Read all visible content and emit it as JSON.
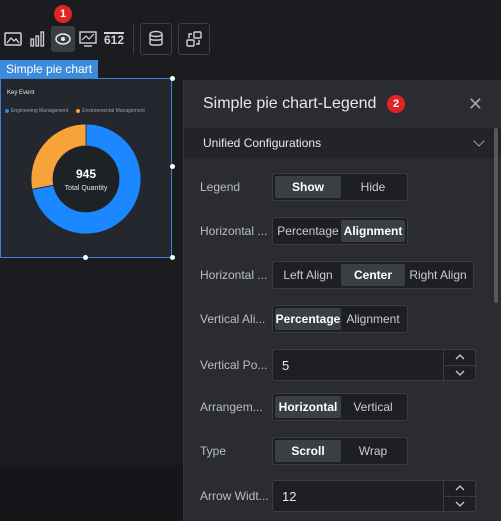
{
  "toolbar": {
    "icons": [
      "image-icon",
      "bar-chart-icon",
      "eye-icon",
      "screen-icon",
      "number-icon",
      "database-icon",
      "exchange-icon"
    ],
    "number_text": "612",
    "badge": "1"
  },
  "component": {
    "label": "Simple pie chart",
    "chart_title": "Key Event",
    "legend": [
      {
        "name": "Engineering Management",
        "color": "#1b88ff"
      },
      {
        "name": "Environmental Management",
        "color": "#f7a33a"
      }
    ],
    "total_value": "945",
    "total_label": "Total Quantity"
  },
  "chart_data": {
    "type": "pie",
    "title": "Key Event",
    "series": [
      {
        "name": "Engineering Management",
        "values": [
          0.72
        ]
      },
      {
        "name": "Environmental Management",
        "values": [
          0.28
        ]
      }
    ],
    "center_value": 945,
    "center_label": "Total Quantity"
  },
  "panel": {
    "title": "Simple pie chart-Legend",
    "badge": "2",
    "section": "Unified Configurations",
    "rows": [
      {
        "label": "Legend",
        "options": [
          "Show",
          "Hide"
        ],
        "selected": 0
      },
      {
        "label": "Horizontal ...",
        "options": [
          "Percentage",
          "Alignment"
        ],
        "selected": 1
      },
      {
        "label": "Horizontal ...",
        "options": [
          "Left Align",
          "Center",
          "Right Align"
        ],
        "selected": 1
      },
      {
        "label": "Vertical Ali...",
        "options": [
          "Percentage",
          "Alignment"
        ],
        "selected": 0
      },
      {
        "label": "Vertical Po...",
        "value": "5"
      },
      {
        "label": "Arrangem...",
        "options": [
          "Horizontal",
          "Vertical"
        ],
        "selected": 0
      },
      {
        "label": "Type",
        "options": [
          "Scroll",
          "Wrap"
        ],
        "selected": 0
      },
      {
        "label": "Arrow Widt...",
        "value": "12"
      }
    ]
  },
  "colors": {
    "accent": "#3d8cdc",
    "badge": "#e02424",
    "series_blue": "#1b88ff",
    "series_orange": "#f7a33a"
  }
}
